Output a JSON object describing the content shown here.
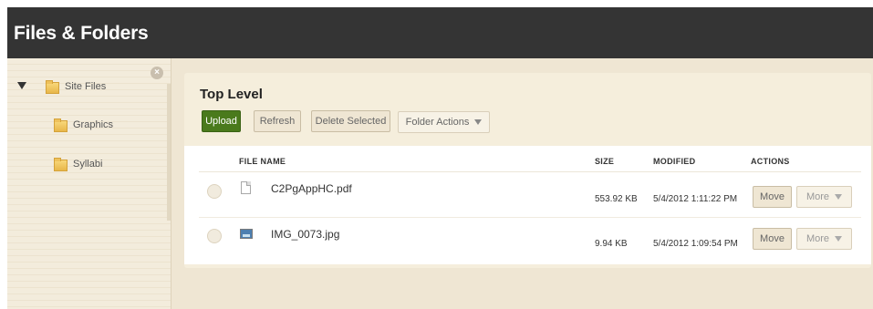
{
  "header": {
    "title": "Files & Folders"
  },
  "sidebar": {
    "items": [
      {
        "label": "Site Files",
        "expanded": true,
        "icon": "folder-icon"
      },
      {
        "label": "Graphics",
        "icon": "folder-icon"
      },
      {
        "label": "Syllabi",
        "icon": "folder-icon"
      }
    ],
    "close_icon": "close-icon"
  },
  "main": {
    "title": "Top Level",
    "toolbar": {
      "upload_label": "Upload",
      "refresh_label": "Refresh",
      "delete_label": "Delete Selected",
      "folder_actions_label": "Folder Actions"
    },
    "table": {
      "columns": [
        "FILE NAME",
        "SIZE",
        "MODIFIED",
        "ACTIONS"
      ],
      "rows": [
        {
          "name": "C2PgAppHC.pdf",
          "icon": "pdf-file-icon",
          "size": "553.92 KB",
          "modified": "5/4/2012 1:11:22 PM",
          "move_label": "Move",
          "more_label": "More"
        },
        {
          "name": "IMG_0073.jpg",
          "icon": "image-file-icon",
          "size": "9.94 KB",
          "modified": "5/4/2012 1:09:54 PM",
          "move_label": "Move",
          "more_label": "More"
        }
      ]
    }
  },
  "colors": {
    "titlebar": "#343434",
    "upload_button": "#4a7a1c",
    "panel_bg": "#f5eedc",
    "body_bg": "#efe6d3"
  }
}
